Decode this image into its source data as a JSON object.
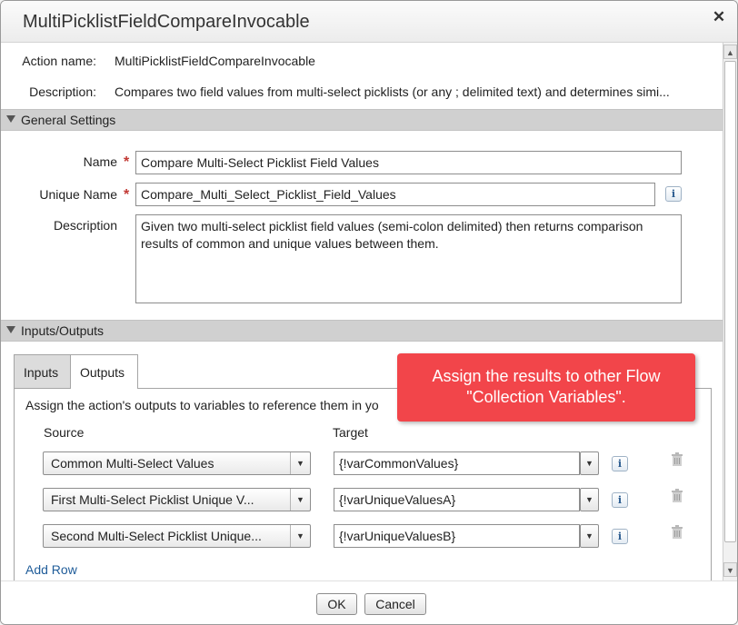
{
  "dialog": {
    "title": "MultiPicklistFieldCompareInvocable",
    "close_icon": "close-icon"
  },
  "info": {
    "action_name_label": "Action name:",
    "action_name_value": "MultiPicklistFieldCompareInvocable",
    "description_label": "Description:",
    "description_value": "Compares two field values from multi-select picklists (or any ; delimited text) and determines simi..."
  },
  "general_settings": {
    "header": "General Settings",
    "name_label": "Name",
    "name_value": "Compare Multi-Select Picklist Field Values",
    "unique_name_label": "Unique Name",
    "unique_name_value": "Compare_Multi_Select_Picklist_Field_Values",
    "description_label": "Description",
    "description_value": "Given two multi-select picklist field values (semi-colon delimited) then returns comparison results of common and unique values between them.",
    "required_marker": "*",
    "info_icon_glyph": "i"
  },
  "io": {
    "header": "Inputs/Outputs",
    "tabs": [
      {
        "label": "Inputs",
        "active": false
      },
      {
        "label": "Outputs",
        "active": true
      }
    ],
    "instruction": "Assign the action's outputs to variables to reference them in yo",
    "source_header": "Source",
    "target_header": "Target",
    "rows": [
      {
        "source": "Common Multi-Select Values",
        "target": "{!varCommonValues}"
      },
      {
        "source": "First Multi-Select Picklist Unique V...",
        "target": "{!varUniqueValuesA}"
      },
      {
        "source": "Second Multi-Select Picklist Unique...",
        "target": "{!varUniqueValuesB}"
      }
    ],
    "add_row": "Add Row"
  },
  "callout": {
    "text": "Assign the results to other Flow \"Collection Variables\"."
  },
  "footer": {
    "ok": "OK",
    "cancel": "Cancel"
  },
  "colors": {
    "callout_bg": "#f2454a",
    "section_bar": "#d0d0d0",
    "link": "#1f5c99",
    "required": "#c23934"
  }
}
